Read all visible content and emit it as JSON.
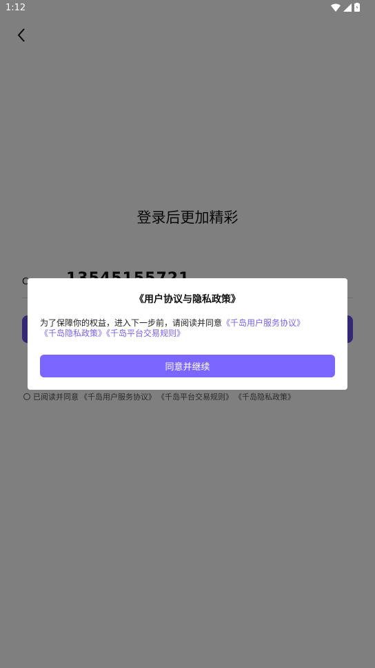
{
  "status_bar": {
    "time": "1:12"
  },
  "login": {
    "headline": "登录后更加精彩",
    "country_code": "C",
    "phone_number": "13545155721"
  },
  "agreement": {
    "prefix": "已阅读并同意",
    "link_service": "《千岛用户服务协议》",
    "link_trade": "《千岛平台交易规则》",
    "link_privacy": "《千岛隐私政策》"
  },
  "dialog": {
    "title": "《用户协议与隐私政策》",
    "body_prefix": "为了保障你的权益，进入下一步前，请阅读并同意",
    "link_service": "《千岛用户服务协议》",
    "link_privacy": "《千岛隐私政策》",
    "link_trade": "《千岛平台交易规则》",
    "confirm_label": "同意并继续"
  },
  "colors": {
    "overlay": "rgba(0,0,0,0.5)",
    "accent": "#7b66ff",
    "link": "#7763ef",
    "login_button": "#6b4ee6"
  }
}
